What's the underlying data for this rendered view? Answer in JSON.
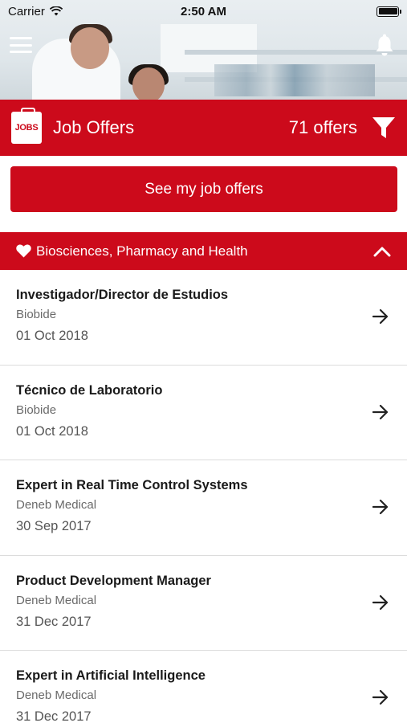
{
  "status_bar": {
    "carrier": "Carrier",
    "time": "2:50 AM"
  },
  "header": {
    "jobs_badge": "JOBS",
    "title": "Job Offers",
    "count": "71 offers"
  },
  "see_offers_button": "See my job offers",
  "category": {
    "label": "Biosciences, Pharmacy and Health",
    "icon": "heart-icon",
    "expanded": true
  },
  "offers": [
    {
      "title": "Investigador/Director de Estudios",
      "company": "Biobide",
      "date": "01 Oct 2018"
    },
    {
      "title": "Técnico de Laboratorio",
      "company": "Biobide",
      "date": "01 Oct 2018"
    },
    {
      "title": "Expert in Real Time Control Systems",
      "company": "Deneb Medical",
      "date": "30 Sep 2017"
    },
    {
      "title": "Product Development Manager",
      "company": "Deneb Medical",
      "date": "31 Dec 2017"
    },
    {
      "title": "Expert in Artificial Intelligence",
      "company": "Deneb Medical",
      "date": "31 Dec 2017"
    }
  ],
  "colors": {
    "brand_red": "#cc0a1b",
    "divider": "#dcdcdc"
  }
}
